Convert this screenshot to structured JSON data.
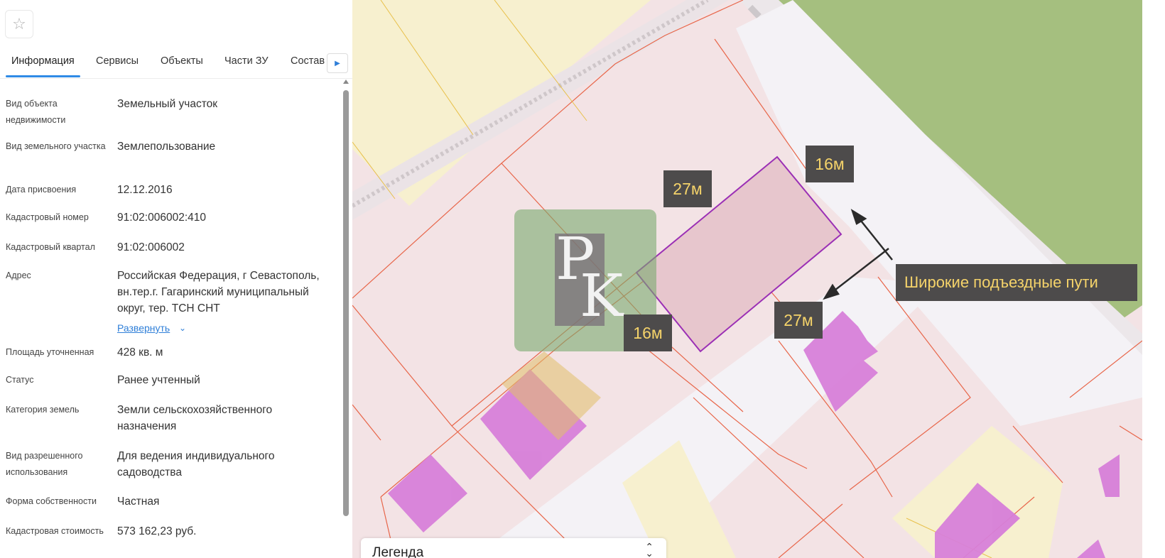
{
  "panel": {
    "tabs": [
      {
        "label": "Информация",
        "active": true
      },
      {
        "label": "Сервисы"
      },
      {
        "label": "Объекты"
      },
      {
        "label": "Части ЗУ"
      },
      {
        "label": "Состав"
      }
    ],
    "rows": [
      {
        "label": "Вид объекта недвижимости",
        "value": "Земельный участок"
      },
      {
        "label": "Вид земельного участка",
        "value": "Землепользование"
      },
      {
        "label": "Дата присвоения",
        "value": "12.12.2016"
      },
      {
        "label": "Кадастровый номер",
        "value": "91:02:006002:410"
      },
      {
        "label": "Кадастровый квартал",
        "value": "91:02:006002"
      },
      {
        "label": "Адрес",
        "value": "Российская Федерация, г Севастополь, вн.тер.г. Гагаринский муниципальный округ, тер. ТСН СНТ"
      },
      {
        "label": "Площадь уточненная",
        "value": "428 кв. м"
      },
      {
        "label": "Статус",
        "value": "Ранее учтенный"
      },
      {
        "label": "Категория земель",
        "value": "Земли сельскохозяйственного назначения"
      },
      {
        "label": "Вид разрешенного использования",
        "value": "Для ведения индивидуального садоводства"
      },
      {
        "label": "Форма собственности",
        "value": "Частная"
      },
      {
        "label": "Кадастровая стоимость",
        "value": "573 162,23 руб."
      }
    ],
    "expand_label": "Развернуть"
  },
  "map": {
    "dims": {
      "top_left": "27м",
      "top_right": "16м",
      "bottom_right": "27м",
      "bottom_left": "16м"
    },
    "callout": "Широкие подъездные пути",
    "logo": {
      "letter1": "P",
      "letter2": "K"
    },
    "legend_title": "Легенда"
  },
  "colors": {
    "accent": "#2f8be6",
    "label_bg": "#4d4b4b",
    "label_text": "#f5d36a",
    "parcel_outline": "#9b2fb5",
    "boundary": "#e8664a",
    "building": "#d77fd9"
  }
}
